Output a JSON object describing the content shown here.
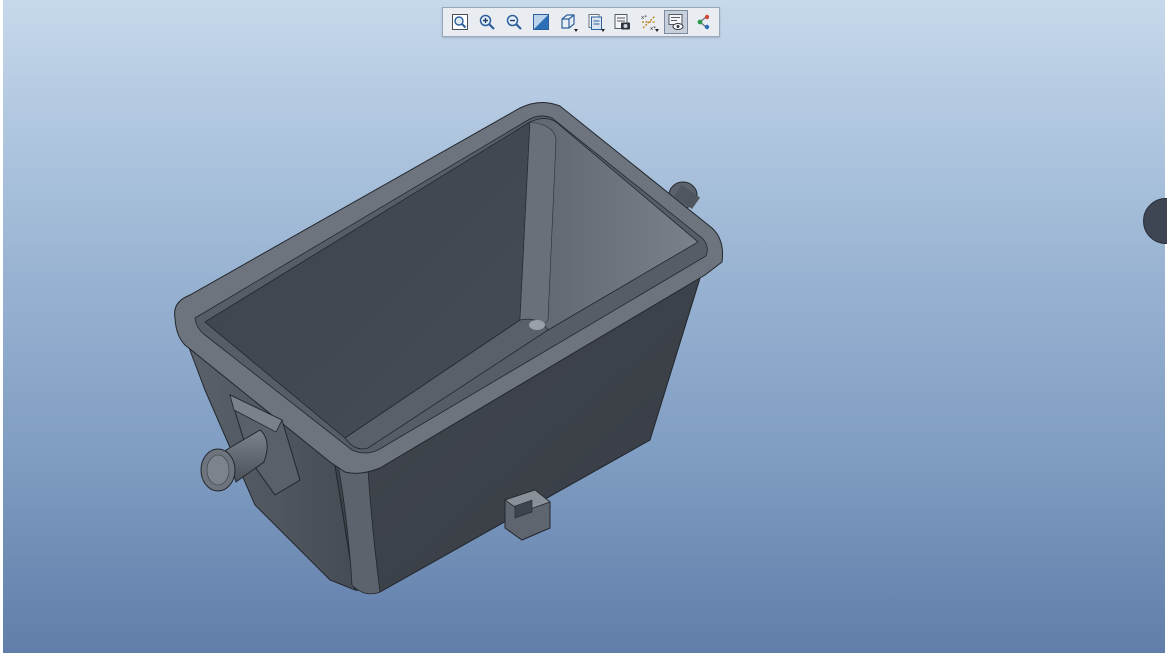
{
  "viewport": {
    "background_top": "#c6d8eb",
    "background_bottom": "#607ea9"
  },
  "toolbar": {
    "buttons": [
      {
        "name": "refit-button",
        "icon": "zoom-fit-icon"
      },
      {
        "name": "zoom-in-button",
        "icon": "zoom-in-icon"
      },
      {
        "name": "zoom-out-button",
        "icon": "zoom-out-icon"
      },
      {
        "name": "repaint-button",
        "icon": "repaint-icon"
      },
      {
        "name": "display-style-button",
        "icon": "cube-icon",
        "dropdown": true
      },
      {
        "name": "saved-views-button",
        "icon": "saved-views-icon",
        "dropdown": true
      },
      {
        "name": "view-manager-button",
        "icon": "view-manager-icon"
      },
      {
        "name": "datum-display-button",
        "icon": "datum-axes-icon",
        "dropdown": true
      },
      {
        "name": "annotation-display-button",
        "icon": "annotation-display-icon",
        "active": true
      },
      {
        "name": "spin-center-button",
        "icon": "spin-center-icon"
      }
    ]
  },
  "model": {
    "body_color": "#4a5059",
    "inner_color": "#3d434b",
    "rim_color": "#6d737c",
    "edge_color": "#23272d"
  }
}
